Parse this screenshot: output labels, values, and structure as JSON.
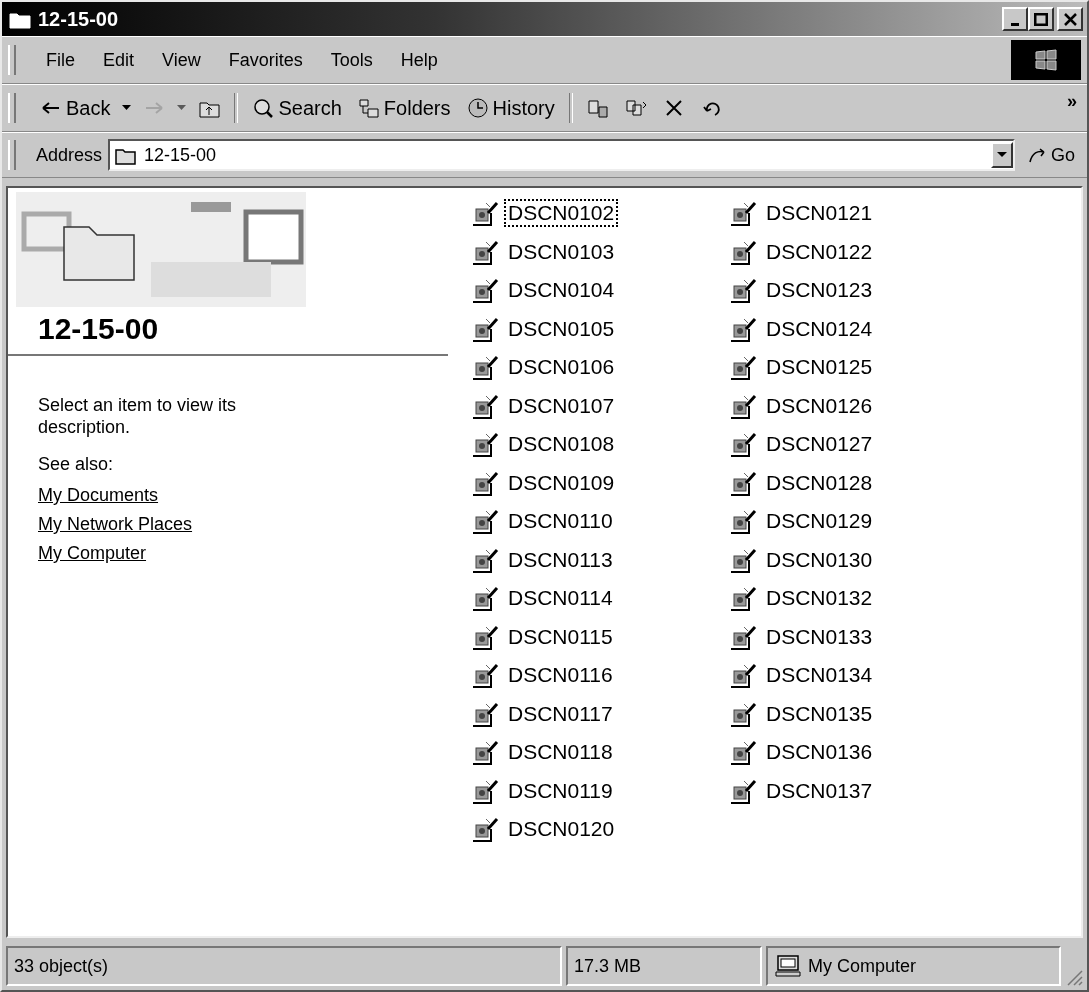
{
  "window": {
    "title": "12-15-00"
  },
  "menu": [
    "File",
    "Edit",
    "View",
    "Favorites",
    "Tools",
    "Help"
  ],
  "toolbar": {
    "buttons": [
      {
        "kind": "back",
        "label": "Back",
        "disabled": false
      },
      {
        "kind": "dropdown",
        "disabled": false
      },
      {
        "kind": "forward",
        "disabled": true
      },
      {
        "kind": "dropdown",
        "disabled": true
      },
      {
        "kind": "up",
        "disabled": false
      },
      {
        "kind": "separator"
      },
      {
        "kind": "search",
        "label": "Search",
        "disabled": false
      },
      {
        "kind": "folders",
        "label": "Folders",
        "disabled": false
      },
      {
        "kind": "history",
        "label": "History",
        "disabled": false
      },
      {
        "kind": "separator"
      },
      {
        "kind": "move",
        "disabled": false
      },
      {
        "kind": "copy",
        "disabled": false
      },
      {
        "kind": "delete",
        "disabled": false
      },
      {
        "kind": "undo",
        "disabled": false
      }
    ],
    "more": "»"
  },
  "address": {
    "label": "Address",
    "value": "12-15-00",
    "go": "Go"
  },
  "info_pane": {
    "title": "12-15-00",
    "description": "Select an item to view its description.",
    "see_also": "See also:",
    "links": [
      "My Documents",
      "My Network Places",
      "My Computer"
    ]
  },
  "files": [
    {
      "name": "DSCN0102",
      "focused": true
    },
    {
      "name": "DSCN0103",
      "focused": false
    },
    {
      "name": "DSCN0104",
      "focused": false
    },
    {
      "name": "DSCN0105",
      "focused": false
    },
    {
      "name": "DSCN0106",
      "focused": false
    },
    {
      "name": "DSCN0107",
      "focused": false
    },
    {
      "name": "DSCN0108",
      "focused": false
    },
    {
      "name": "DSCN0109",
      "focused": false
    },
    {
      "name": "DSCN0110",
      "focused": false
    },
    {
      "name": "DSCN0113",
      "focused": false
    },
    {
      "name": "DSCN0114",
      "focused": false
    },
    {
      "name": "DSCN0115",
      "focused": false
    },
    {
      "name": "DSCN0116",
      "focused": false
    },
    {
      "name": "DSCN0117",
      "focused": false
    },
    {
      "name": "DSCN0118",
      "focused": false
    },
    {
      "name": "DSCN0119",
      "focused": false
    },
    {
      "name": "DSCN0120",
      "focused": false
    },
    {
      "name": "DSCN0121",
      "focused": false
    },
    {
      "name": "DSCN0122",
      "focused": false
    },
    {
      "name": "DSCN0123",
      "focused": false
    },
    {
      "name": "DSCN0124",
      "focused": false
    },
    {
      "name": "DSCN0125",
      "focused": false
    },
    {
      "name": "DSCN0126",
      "focused": false
    },
    {
      "name": "DSCN0127",
      "focused": false
    },
    {
      "name": "DSCN0128",
      "focused": false
    },
    {
      "name": "DSCN0129",
      "focused": false
    },
    {
      "name": "DSCN0130",
      "focused": false
    },
    {
      "name": "DSCN0132",
      "focused": false
    },
    {
      "name": "DSCN0133",
      "focused": false
    },
    {
      "name": "DSCN0134",
      "focused": false
    },
    {
      "name": "DSCN0135",
      "focused": false
    },
    {
      "name": "DSCN0136",
      "focused": false
    },
    {
      "name": "DSCN0137",
      "focused": false
    }
  ],
  "status_bar": {
    "objects": "33 object(s)",
    "size": "17.3 MB",
    "zone": "My Computer"
  }
}
